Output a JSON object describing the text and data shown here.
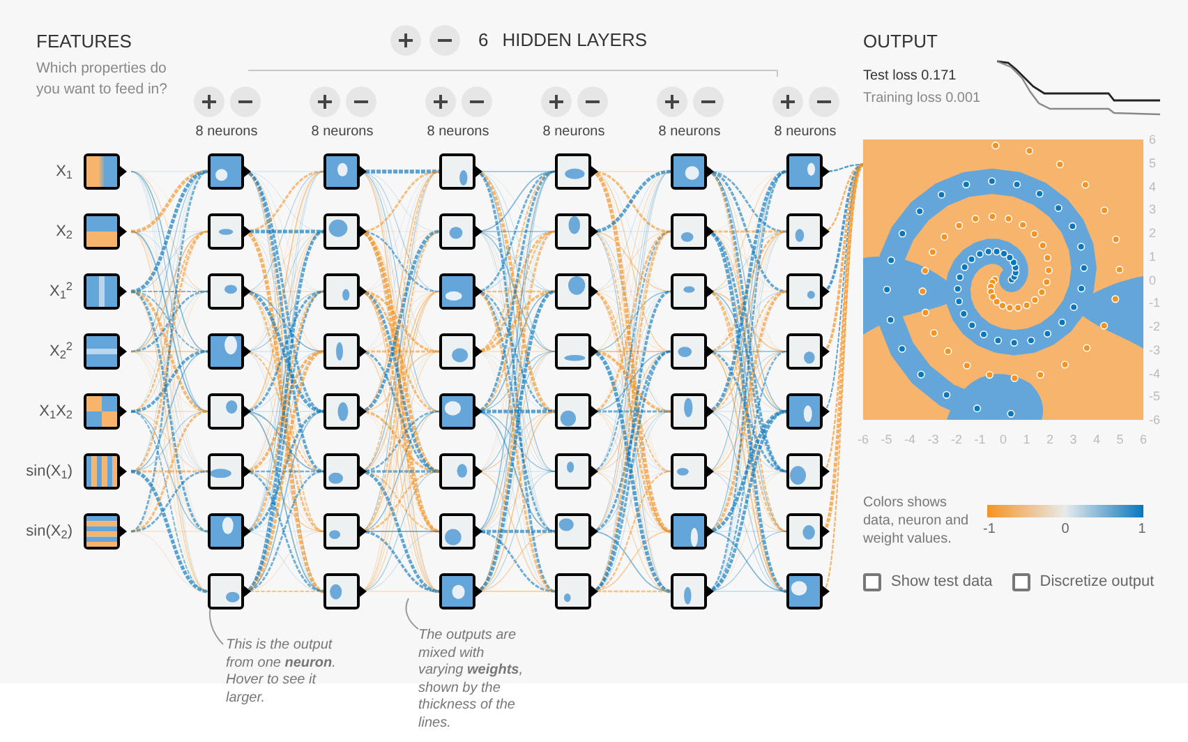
{
  "features_panel": {
    "title": "FEATURES",
    "subtitle": "Which properties do you want to feed in?"
  },
  "features": [
    {
      "label": "X$_{1}$",
      "kind": "x1"
    },
    {
      "label": "X$_{2}$",
      "kind": "x2"
    },
    {
      "label": "X$_{1}$$^{2}$",
      "kind": "x1sq"
    },
    {
      "label": "X$_{2}$$^{2}$",
      "kind": "x2sq"
    },
    {
      "label": "X$_{1}$X$_{2}$",
      "kind": "x1x2"
    },
    {
      "label": "sin(X$_{1}$)",
      "kind": "sinx1"
    },
    {
      "label": "sin(X$_{2}$)",
      "kind": "sinx2"
    }
  ],
  "hidden_layers": {
    "count": "6",
    "title": "HIDDEN LAYERS",
    "layers": [
      {
        "neurons_label": "8 neurons",
        "neurons": [
          {
            "mostly_blue": true
          },
          {
            "mostly_blue": false
          },
          {
            "mostly_blue": false
          },
          {
            "mostly_blue": true
          },
          {
            "mostly_blue": false
          },
          {
            "mostly_blue": false
          },
          {
            "mostly_blue": true
          },
          {
            "mostly_blue": false
          }
        ]
      },
      {
        "neurons_label": "8 neurons",
        "neurons": [
          {
            "mostly_blue": true
          },
          {
            "mostly_blue": false
          },
          {
            "mostly_blue": false
          },
          {
            "mostly_blue": false
          },
          {
            "mostly_blue": false
          },
          {
            "mostly_blue": false
          },
          {
            "mostly_blue": false
          },
          {
            "mostly_blue": false
          }
        ]
      },
      {
        "neurons_label": "8 neurons",
        "neurons": [
          {
            "mostly_blue": false
          },
          {
            "mostly_blue": false
          },
          {
            "mostly_blue": true
          },
          {
            "mostly_blue": false
          },
          {
            "mostly_blue": true
          },
          {
            "mostly_blue": false
          },
          {
            "mostly_blue": false
          },
          {
            "mostly_blue": true
          }
        ]
      },
      {
        "neurons_label": "8 neurons",
        "neurons": [
          {
            "mostly_blue": false
          },
          {
            "mostly_blue": false
          },
          {
            "mostly_blue": false
          },
          {
            "mostly_blue": false
          },
          {
            "mostly_blue": false
          },
          {
            "mostly_blue": false
          },
          {
            "mostly_blue": false
          },
          {
            "mostly_blue": false
          }
        ]
      },
      {
        "neurons_label": "8 neurons",
        "neurons": [
          {
            "mostly_blue": true
          },
          {
            "mostly_blue": false
          },
          {
            "mostly_blue": false
          },
          {
            "mostly_blue": false
          },
          {
            "mostly_blue": false
          },
          {
            "mostly_blue": false
          },
          {
            "mostly_blue": true
          },
          {
            "mostly_blue": false
          }
        ]
      },
      {
        "neurons_label": "8 neurons",
        "neurons": [
          {
            "mostly_blue": true
          },
          {
            "mostly_blue": false
          },
          {
            "mostly_blue": false
          },
          {
            "mostly_blue": false
          },
          {
            "mostly_blue": true
          },
          {
            "mostly_blue": false
          },
          {
            "mostly_blue": false
          },
          {
            "mostly_blue": true
          }
        ]
      }
    ]
  },
  "output": {
    "title": "OUTPUT",
    "test_loss": "Test loss 0.171",
    "training_loss": "Training loss 0.001",
    "y_ticks": [
      "6",
      "5",
      "4",
      "3",
      "2",
      "1",
      "0",
      "-1",
      "-2",
      "-3",
      "-4",
      "-5",
      "-6"
    ],
    "x_ticks": [
      "-6",
      "-5",
      "-4",
      "-3",
      "-2",
      "-1",
      "0",
      "1",
      "2",
      "3",
      "4",
      "5",
      "6"
    ],
    "legend": {
      "text": "Colors shows data, neuron and weight values.",
      "ticks": [
        "-1",
        "0",
        "1"
      ]
    },
    "options": [
      {
        "label": "Show test data",
        "checked": false
      },
      {
        "label": "Discretize output",
        "checked": false
      }
    ]
  },
  "annotations": [
    "This is the output from one **neuron**. Hover to see it larger.",
    "The outputs are mixed with varying **weights**, shown by the thickness of the lines."
  ]
}
